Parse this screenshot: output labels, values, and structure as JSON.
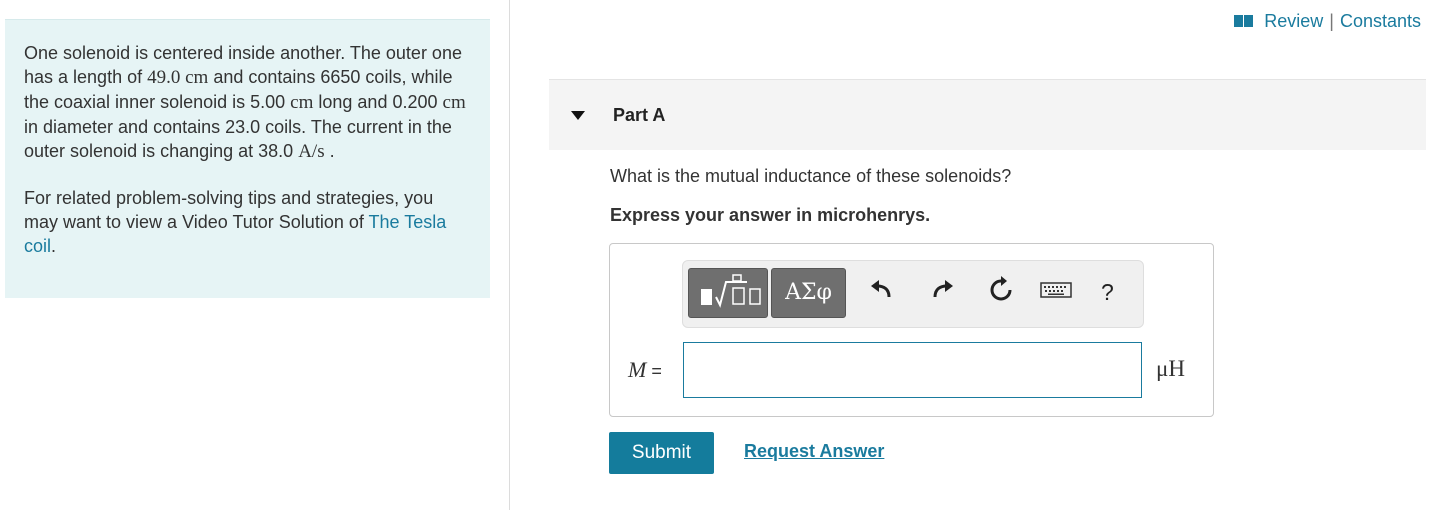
{
  "problem": {
    "intro": {
      "t1": "One solenoid is centered inside another. The outer one has a length of ",
      "m1": "49.0 cm",
      "t2": " and contains 6650 coils, while the coaxial inner solenoid is 5.00 ",
      "m2": "cm",
      "t3": " long and 0.200 ",
      "m3": "cm",
      "t4": " in diameter and contains 23.0 coils. The current in the outer solenoid is changing at 38.0 ",
      "m4": "A/s",
      "t5": " ."
    },
    "tips": {
      "text": "For related problem-solving tips and strategies, you may want to view a Video Tutor Solution of ",
      "link": "The Tesla coil",
      "end": "."
    }
  },
  "header": {
    "review": "Review",
    "separator": "|",
    "constants": "Constants"
  },
  "part": {
    "title": "Part A",
    "question": "What is the mutual inductance of these solenoids?",
    "instruction": "Express your answer in microhenrys."
  },
  "answer": {
    "variable": "M",
    "equals": " =",
    "value": "",
    "unit": "μH"
  },
  "toolbar": {
    "greek_label": "ΑΣφ",
    "help_label": "?"
  },
  "actions": {
    "submit": "Submit",
    "request": "Request Answer"
  },
  "colors": {
    "accent": "#1a7b9e",
    "submit_bg": "#147c9c",
    "problem_bg": "#e6f4f5"
  }
}
